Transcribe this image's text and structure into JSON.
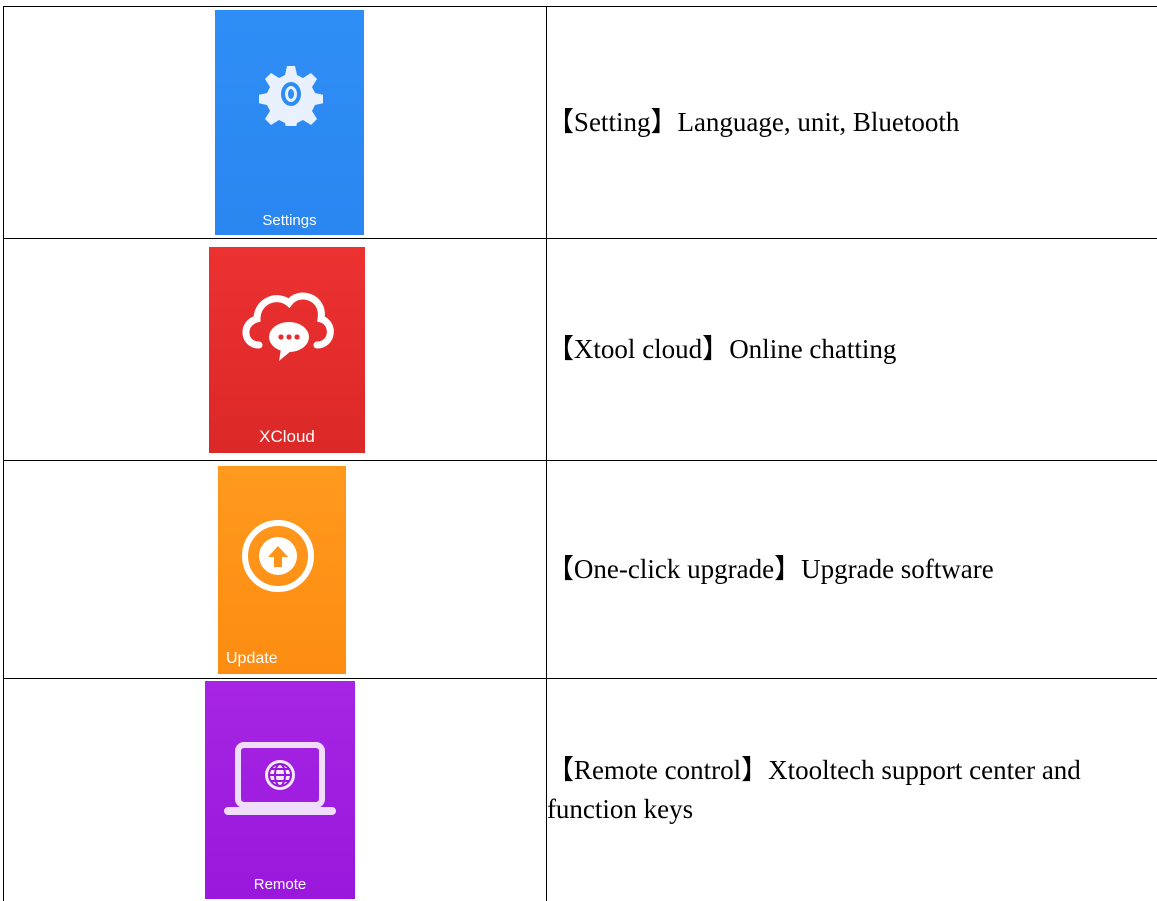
{
  "rows": [
    {
      "tile_label": "Settings",
      "icon": "gear-icon",
      "color": "#2d8cf5",
      "title": "【Setting】",
      "text": "Language, unit, Bluetooth"
    },
    {
      "tile_label": "XCloud",
      "icon": "cloud-chat-icon",
      "color": "#e52d2d",
      "title": "【Xtool cloud】",
      "text": "Online chatting"
    },
    {
      "tile_label": "Update",
      "icon": "upload-arrow-icon",
      "color": "#ff9418",
      "title": "【One-click upgrade】",
      "text": "Upgrade software"
    },
    {
      "tile_label": "Remote",
      "icon": "laptop-globe-icon",
      "color": "#a21fe0",
      "title": "【Remote control】",
      "text": "Xtooltech support center and function keys"
    }
  ]
}
